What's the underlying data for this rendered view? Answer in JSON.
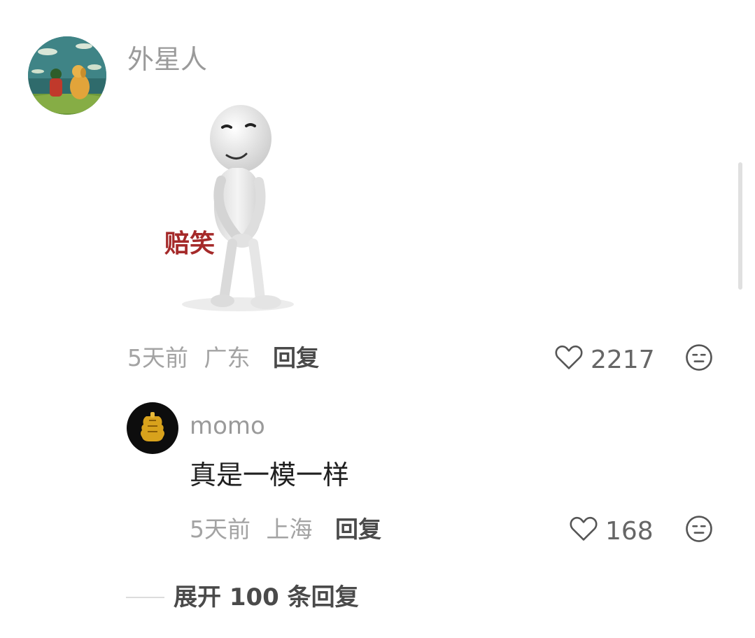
{
  "comment": {
    "username": "外星人",
    "sticker_caption": "赔笑",
    "time": "5天前",
    "location": "广东",
    "reply_label": "回复",
    "like_count": "2217"
  },
  "sub_reply": {
    "username": "momo",
    "text": "真是一模一样",
    "time": "5天前",
    "location": "上海",
    "reply_label": "回复",
    "like_count": "168"
  },
  "expand_replies": {
    "label": "展开 100 条回复"
  },
  "icons": {
    "like": "heart-outline-icon",
    "dislike": "neutral-face-icon"
  },
  "colors": {
    "text_muted": "#9a9a9a",
    "text_strong": "#4a4a4a",
    "caption_red": "#a52a2a"
  }
}
